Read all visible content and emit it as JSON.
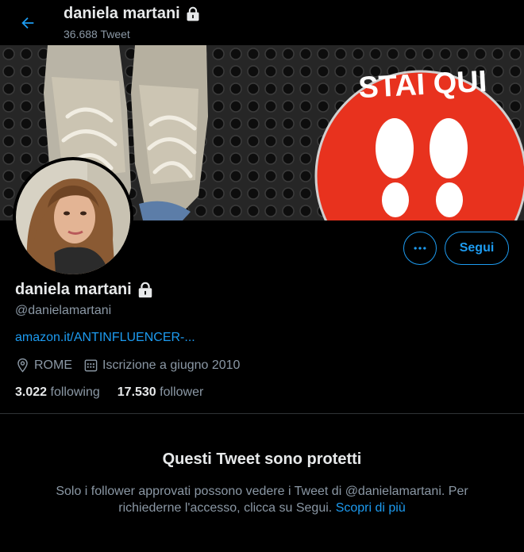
{
  "header": {
    "name": "daniela martani",
    "tweet_count": "36.688 Tweet"
  },
  "banner": {
    "sign_text": "STAI QUI"
  },
  "profile": {
    "name": "daniela martani",
    "handle": "@danielamartani",
    "link": "amazon.it/ANTINFLUENCER-...",
    "location": "ROME",
    "joined": "Iscrizione a giugno 2010",
    "following_count": "3.022",
    "following_label": "following",
    "follower_count": "17.530",
    "follower_label": "follower"
  },
  "actions": {
    "follow_label": "Segui"
  },
  "protected": {
    "title": "Questi Tweet sono protetti",
    "text": "Solo i follower approvati possono vedere i Tweet di @danielamartani. Per richiederne l'accesso, clicca su Segui.",
    "link": "Scopri di più"
  },
  "colors": {
    "accent": "#1d9bf0",
    "background": "#000000",
    "secondary_text": "#8b98a5",
    "sign_red": "#e8321e"
  },
  "icons": [
    "back-arrow-icon",
    "lock-icon",
    "more-icon",
    "location-icon",
    "calendar-icon"
  ]
}
